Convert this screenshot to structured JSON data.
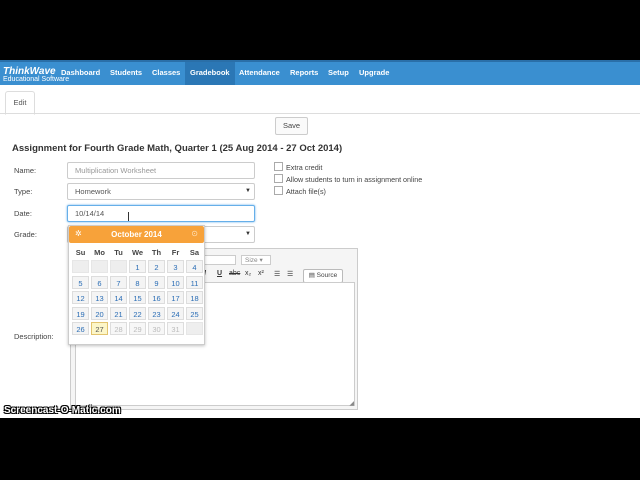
{
  "app": {
    "logo": "ThinkWave",
    "logo_sub": "Educational Software"
  },
  "nav": {
    "items": [
      "Dashboard",
      "Students",
      "Classes",
      "Gradebook",
      "Attendance",
      "Reports",
      "Setup",
      "Upgrade"
    ],
    "active": "Gradebook"
  },
  "tabs": {
    "edit": "Edit"
  },
  "toolbar": {
    "save_label": "Save"
  },
  "page": {
    "title": "Assignment for Fourth Grade Math, Quarter 1 (25 Aug 2014 - 27 Oct 2014)"
  },
  "form": {
    "name_label": "Name:",
    "name_placeholder": "Multiplication Worksheet",
    "type_label": "Type:",
    "type_value": "Homework",
    "date_label": "Date:",
    "date_value": "10/14/14",
    "grade_label": "Grade:",
    "description_label": "Description:"
  },
  "options": {
    "extra_credit": "Extra credit",
    "turn_in_online": "Allow students to turn in assignment online",
    "attach_files": "Attach file(s)"
  },
  "editor": {
    "size_label": "Size",
    "source_label": "Source",
    "font_partial": "nt"
  },
  "datepicker": {
    "month_label": "October 2014",
    "weekdays": [
      "Su",
      "Mo",
      "Tu",
      "We",
      "Th",
      "Fr",
      "Sa"
    ],
    "weeks": [
      [
        "",
        "",
        "",
        "1",
        "2",
        "3",
        "4"
      ],
      [
        "5",
        "6",
        "7",
        "8",
        "9",
        "10",
        "11"
      ],
      [
        "12",
        "13",
        "14",
        "15",
        "16",
        "17",
        "18"
      ],
      [
        "19",
        "20",
        "21",
        "22",
        "23",
        "24",
        "25"
      ],
      [
        "26",
        "27",
        "28",
        "29",
        "30",
        "31",
        ""
      ]
    ],
    "highlighted_day": "27",
    "accent_color": "#f7a23a"
  },
  "watermark": "Screencast-O-Matic.com",
  "colors": {
    "navbar": "#3a8fd0",
    "nav_active": "#2b77b5",
    "link": "#2a6db5"
  }
}
